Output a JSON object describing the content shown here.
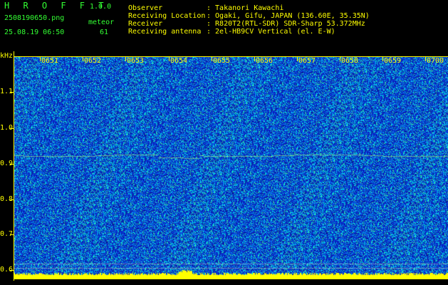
{
  "header": {
    "app_title": "H R O F F T",
    "version": "1.0.0",
    "filename": "2508190650.png",
    "datetime": "25.08.19 06:50",
    "meteor_label": "meteor",
    "meteor_count": "61",
    "fields": [
      {
        "label": "Observer",
        "value": ": Takanori Kawachi"
      },
      {
        "label": "Receiving Location",
        "value": ": Ogaki, Gifu, JAPAN (136.60E, 35.35N)"
      },
      {
        "label": "Receiver",
        "value": ": R820T2(RTL-SDR) SDR-Sharp 53.372MHz"
      },
      {
        "label": "Receiving antenna",
        "value": ": 2el-HB9CV Vertical (el. E-W)"
      }
    ]
  },
  "plot": {
    "yunit": "kHz",
    "yticks": [
      "1.1",
      "1.0",
      "0.9",
      "0.8",
      "0.7",
      "0.6"
    ],
    "xticks": [
      "0651",
      "0652",
      "0653",
      "0654",
      "0655",
      "0656",
      "0657",
      "0658",
      "0659",
      "0700"
    ],
    "colors": {
      "background": "#0a1fb8",
      "signal": "#00e5ff",
      "noise_floor": "#ffff00",
      "axis": "#ffff00"
    }
  }
}
